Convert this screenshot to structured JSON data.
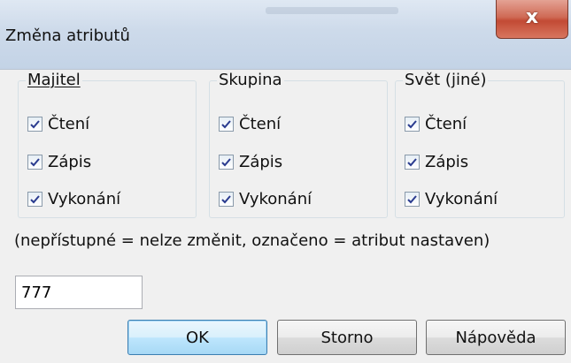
{
  "window": {
    "title": "Změna atributů",
    "close_glyph": "x"
  },
  "groups": [
    {
      "label": "Majitel",
      "items": [
        {
          "label": "Čtení",
          "checked": true
        },
        {
          "label": "Zápis",
          "checked": true
        },
        {
          "label": "Vykonání",
          "checked": true
        }
      ]
    },
    {
      "label": "Skupina",
      "items": [
        {
          "label": "Čtení",
          "checked": true
        },
        {
          "label": "Zápis",
          "checked": true
        },
        {
          "label": "Vykonání",
          "checked": true
        }
      ]
    },
    {
      "label": "Svět (jiné)",
      "items": [
        {
          "label": "Čtení",
          "checked": true
        },
        {
          "label": "Zápis",
          "checked": true
        },
        {
          "label": "Vykonání",
          "checked": true
        }
      ]
    }
  ],
  "note": "(nepřístupné = nelze změnit, označeno = atribut nastaven)",
  "octal_value": "777",
  "buttons": {
    "ok": "OK",
    "cancel": "Storno",
    "help": "Nápověda"
  },
  "colors": {
    "check": "#2a3b8f",
    "title_bar": "#cddaea",
    "close_button": "#c24a34"
  }
}
